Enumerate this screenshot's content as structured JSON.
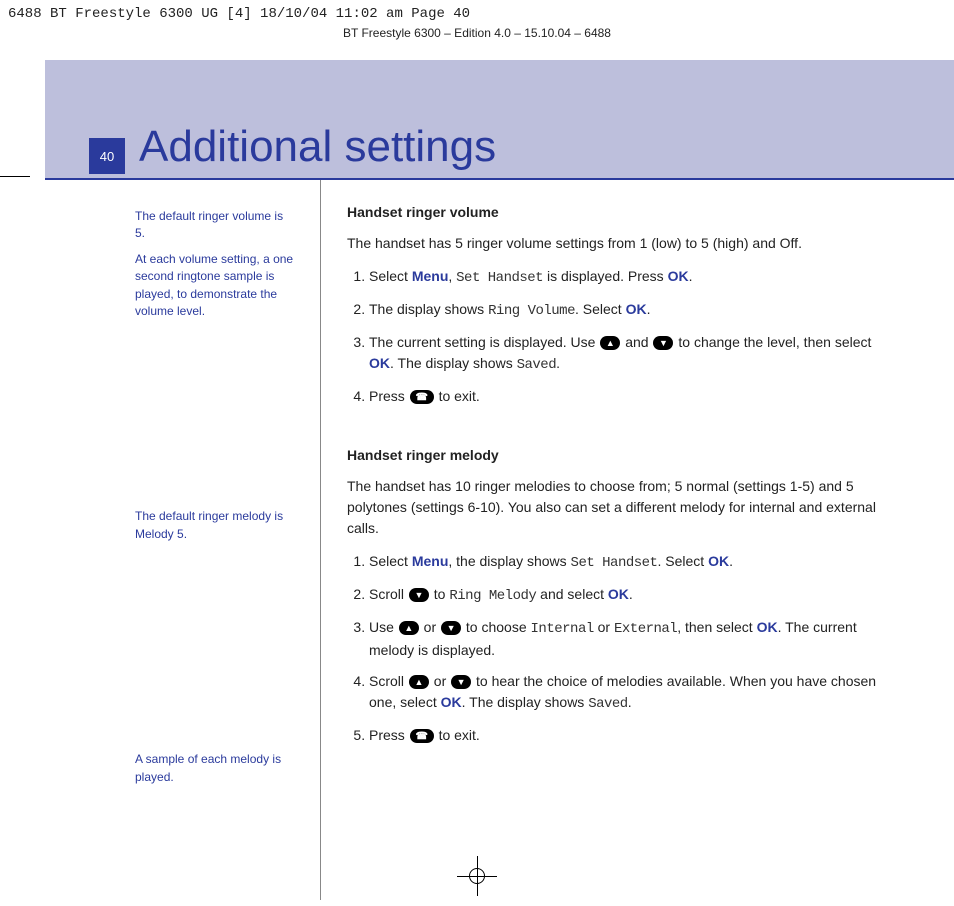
{
  "meta": {
    "print_line": "6488 BT Freestyle 6300 UG [4]  18/10/04  11:02 am  Page 40",
    "edition": "BT Freestyle 6300 – Edition 4.0 – 15.10.04 – 6488"
  },
  "header": {
    "page_number": "40",
    "title": "Additional settings"
  },
  "side": {
    "note1a": "The default ringer volume is 5.",
    "note1b": "At each volume setting, a one second ringtone sample is played, to demonstrate the volume level.",
    "note2": "The default ringer melody is Melody 5.",
    "note3": "A sample of each melody is played."
  },
  "sections": {
    "vol": {
      "heading": "Handset ringer volume",
      "intro": "The handset has 5 ringer volume settings from 1 (low) to 5 (high) and Off.",
      "s1a": "Select ",
      "s1b": "Menu",
      "s1c": ", ",
      "s1d": "Set Handset",
      "s1e": " is displayed. Press ",
      "s1f": "OK",
      "s1g": ".",
      "s2a": "The display shows ",
      "s2b": "Ring Volume",
      "s2c": ". Select ",
      "s2d": "OK",
      "s2e": ".",
      "s3a": "The current setting is displayed. Use ",
      "s3b": " and ",
      "s3c": " to change the level, then select ",
      "s3d": "OK",
      "s3e": ". The display shows ",
      "s3f": "Saved",
      "s3g": ".",
      "s4a": "Press ",
      "s4b": " to exit."
    },
    "mel": {
      "heading": "Handset ringer melody",
      "intro": "The handset has 10 ringer melodies to choose from; 5 normal (settings 1-5) and 5 polytones (settings 6-10). You also can set a different melody for internal and external calls.",
      "s1a": "Select ",
      "s1b": "Menu",
      "s1c": ", the display shows ",
      "s1d": "Set Handset",
      "s1e": ". Select ",
      "s1f": "OK",
      "s1g": ".",
      "s2a": "Scroll ",
      "s2b": " to ",
      "s2c": "Ring Melody",
      "s2d": " and select ",
      "s2e": "OK",
      "s2f": ".",
      "s3a": "Use ",
      "s3b": " or ",
      "s3c": " to choose ",
      "s3d": "Internal",
      "s3e": " or ",
      "s3f": "External",
      "s3g": ", then select ",
      "s3h": "OK",
      "s3i": ". The current melody is displayed.",
      "s4a": "Scroll ",
      "s4b": " or ",
      "s4c": " to hear the choice of melodies available. When you have chosen one, select ",
      "s4d": "OK",
      "s4e": ". The display shows ",
      "s4f": "Saved",
      "s4g": ".",
      "s5a": "Press ",
      "s5b": " to exit."
    }
  }
}
